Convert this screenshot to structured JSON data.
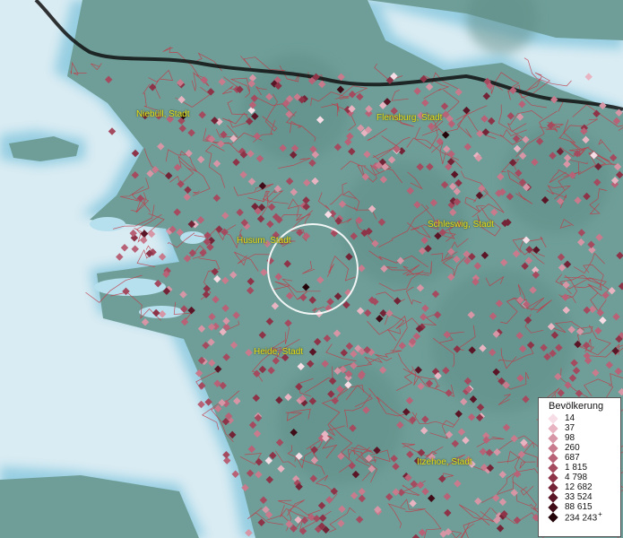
{
  "map": {
    "towns": [
      {
        "name": "Niebüll, Stadt"
      },
      {
        "name": "Flensburg, Stadt"
      },
      {
        "name": "Schleswig, Stadt"
      },
      {
        "name": "Husum, Stadt"
      },
      {
        "name": "Heide, Stadt"
      },
      {
        "name": "Itzehoe, Stadt"
      }
    ],
    "colors": {
      "sea": "#d9ecf3",
      "land": "#6f9e98",
      "boundary": "#c23a48",
      "border": "#222222",
      "label": "#e8e21a"
    }
  },
  "legend": {
    "title": "Bevölkerung",
    "entries": [
      {
        "label": "14",
        "color": "#f7dde5"
      },
      {
        "label": "37",
        "color": "#e8b4c1"
      },
      {
        "label": "98",
        "color": "#d696a6"
      },
      {
        "label": "260",
        "color": "#c77b8d"
      },
      {
        "label": "687",
        "color": "#b86277"
      },
      {
        "label": "1 815",
        "color": "#a44b60"
      },
      {
        "label": "4 798",
        "color": "#8e3449"
      },
      {
        "label": "12 682",
        "color": "#742437"
      },
      {
        "label": "33 524",
        "color": "#5a1626"
      },
      {
        "label": "88 615",
        "color": "#3f0c17"
      },
      {
        "label": "234 243",
        "color": "#220409",
        "plus": "+"
      }
    ]
  }
}
